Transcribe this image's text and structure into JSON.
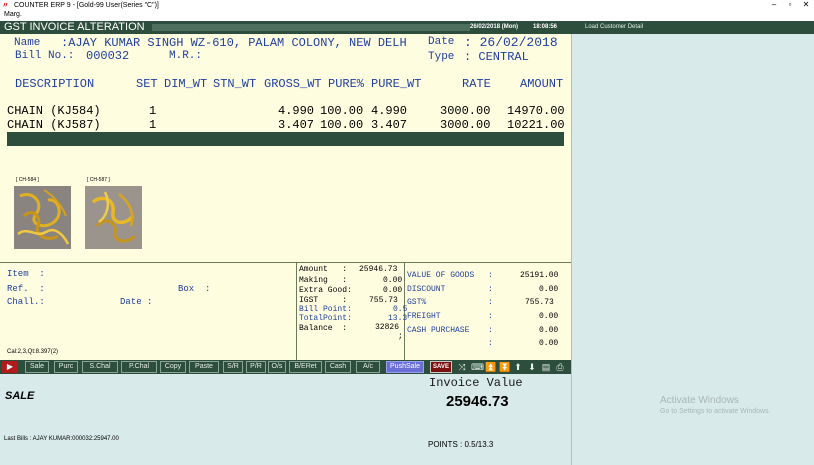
{
  "window": {
    "title": "COUNTER ERP 9 - [Gold-99 User(Series \"C\")]",
    "menu": "Marg."
  },
  "header": {
    "title": "GST INVOICE ALTERATION",
    "date": "26/02/2018 (Mon)",
    "time": "18:08:56",
    "load_customer": "Load Customer Detail"
  },
  "bill": {
    "name_label": "Name",
    "name_value": ":AJAY KUMAR SINGH WZ-610, PALAM COLONY, NEW DELH",
    "bill_no_label": "Bill No.:",
    "bill_no_value": "000032",
    "mr_label": "M.R.:",
    "date_label": "Date",
    "date_value": ": 26/02/2018",
    "type_label": "Type",
    "type_value": ": CENTRAL"
  },
  "columns": [
    "DESCRIPTION",
    "SET",
    "DIM_WT",
    "STN_WT",
    "GROSS_WT",
    "PURE%",
    "PURE_WT",
    "RATE",
    "AMOUNT"
  ],
  "items": [
    {
      "description": "CHAIN (KJ584)",
      "set": "1",
      "gross_wt": "4.990",
      "pure_pct": "100.00",
      "pure_wt": "4.990",
      "rate": "3000.00",
      "amount": "14970.00"
    },
    {
      "description": "CHAIN (KJ587)",
      "set": "1",
      "gross_wt": "3.407",
      "pure_pct": "100.00",
      "pure_wt": "3.407",
      "rate": "3000.00",
      "amount": "10221.00"
    }
  ],
  "thumbnails": [
    {
      "caption": "[ CH-584 ]"
    },
    {
      "caption": "[ CH-587 ]"
    }
  ],
  "item_info": {
    "item_label": "Item  :",
    "ref_label": "Ref.  :",
    "box_label": "Box  :",
    "chall_label": "Chall.:",
    "date_label": "Date :",
    "calc_line": "Cal:2,3,Qt:8.397(2)"
  },
  "summary_mid": {
    "amount_label": "Amount   :",
    "amount_value": "25946.73",
    "making_label": "Making   :",
    "making_value": "0.00",
    "extra_label": "Extra Good:",
    "extra_value": "0.00",
    "igst_label": "IGST     :",
    "igst_value": "755.73",
    "billpoint_label": "Bill Point:",
    "billpoint_value": "0.5",
    "totalpoint_label": "TotalPoint:",
    "totalpoint_value": "13.3",
    "balance_label": "Balance  :",
    "balance_value": "32826",
    "balance_suffix": ";"
  },
  "summary_right": {
    "rows": [
      {
        "label": "VALUE OF GOODS",
        "colon": ":",
        "value": "25191.00"
      },
      {
        "label": "DISCOUNT",
        "colon": ":",
        "value": "0.00"
      },
      {
        "label": "GST%",
        "colon": ":",
        "value": "755.73"
      },
      {
        "label": "FREIGHT",
        "colon": ":",
        "value": "0.00"
      },
      {
        "label": "CASH PURCHASE",
        "colon": ":",
        "value": "0.00"
      },
      {
        "label": "",
        "colon": ":",
        "value": "0.00"
      }
    ]
  },
  "toolbar": {
    "buttons": [
      "Sale",
      "Purc",
      "S.Chal",
      "P.Chal",
      "Copy",
      "Paste",
      "S/R",
      "P/R",
      "O/s",
      "B/ERet",
      "Cash",
      "A/c"
    ],
    "push_sale": "PushSale",
    "save": "SAVE"
  },
  "bottom": {
    "mode": "SALE",
    "invoice_value_label": "Invoice Value",
    "invoice_value": "25946.73",
    "last_bills": "Last Bills : AJAY KUMAR:000032:25947.00",
    "points": "POINTS : 0.5/13.3"
  },
  "watermark": {
    "title": "Activate Windows",
    "subtitle": "Go to Settings to activate Windows."
  },
  "colors": {
    "panel_bg": "#fffde0",
    "header_green": "#2d4d3d",
    "label_blue": "#1f3fa0",
    "bottom_bg": "#d8eae9"
  }
}
